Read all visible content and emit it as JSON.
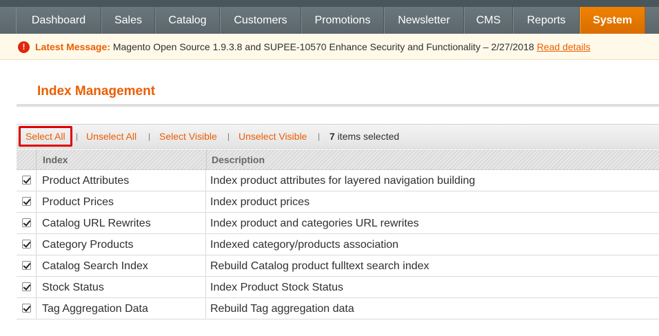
{
  "nav": {
    "items": [
      {
        "label": "Dashboard",
        "active": false
      },
      {
        "label": "Sales",
        "active": false
      },
      {
        "label": "Catalog",
        "active": false
      },
      {
        "label": "Customers",
        "active": false
      },
      {
        "label": "Promotions",
        "active": false
      },
      {
        "label": "Newsletter",
        "active": false
      },
      {
        "label": "CMS",
        "active": false
      },
      {
        "label": "Reports",
        "active": false
      },
      {
        "label": "System",
        "active": true
      }
    ]
  },
  "message": {
    "label": "Latest Message:",
    "text": "Magento Open Source 1.9.3.8 and SUPEE-10570 Enhance Security and Functionality – 2/27/2018",
    "link": "Read details",
    "icon": "alert-icon"
  },
  "page": {
    "title": "Index Management"
  },
  "massaction": {
    "select_all": "Select All",
    "unselect_all": "Unselect All",
    "select_visible": "Select Visible",
    "unselect_visible": "Unselect Visible",
    "separator": "|",
    "count": "7",
    "count_suffix": "items selected"
  },
  "grid": {
    "headers": {
      "index": "Index",
      "description": "Description"
    },
    "rows": [
      {
        "index": "Product Attributes",
        "description": "Index product attributes for layered navigation building",
        "checked": true
      },
      {
        "index": "Product Prices",
        "description": "Index product prices",
        "checked": true
      },
      {
        "index": "Catalog URL Rewrites",
        "description": "Index product and categories URL rewrites",
        "checked": true
      },
      {
        "index": "Category Products",
        "description": "Indexed category/products association",
        "checked": true
      },
      {
        "index": "Catalog Search Index",
        "description": "Rebuild Catalog product fulltext search index",
        "checked": true
      },
      {
        "index": "Stock Status",
        "description": "Index Product Stock Status",
        "checked": true
      },
      {
        "index": "Tag Aggregation Data",
        "description": "Rebuild Tag aggregation data",
        "checked": true
      }
    ]
  },
  "colors": {
    "accent": "#eb5e00",
    "nav_active": "#f18200",
    "highlight": "#e00000"
  }
}
